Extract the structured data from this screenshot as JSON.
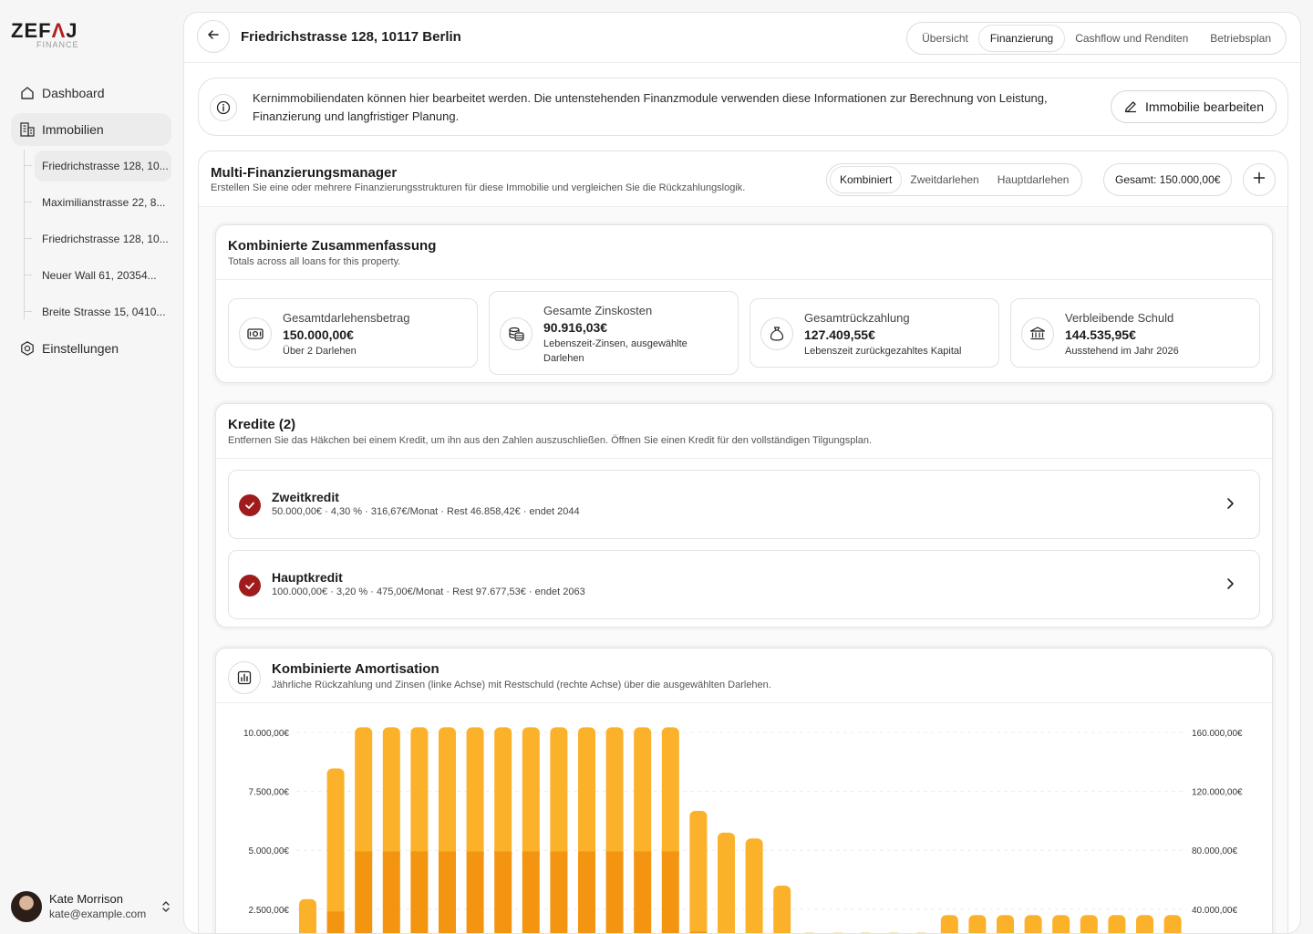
{
  "brand": {
    "name_left": "ZEF",
    "name_accent": "Λ",
    "name_right": "J",
    "sub": "FINANCE"
  },
  "sidebar": {
    "nav": [
      {
        "label": "Dashboard",
        "icon": "home-icon"
      },
      {
        "label": "Immobilien",
        "icon": "building-icon"
      },
      {
        "label": "Einstellungen",
        "icon": "settings-icon"
      }
    ],
    "properties": [
      "Friedrichstrasse 128, 10...",
      "Maximilianstrasse 22, 8...",
      "Friedrichstrasse 128, 10...",
      "Neuer Wall 61, 20354...",
      "Breite Strasse 15, 0410..."
    ],
    "user": {
      "name": "Kate Morrison",
      "email": "kate@example.com"
    }
  },
  "header": {
    "title": "Friedrichstrasse 128, 10117 Berlin",
    "tabs": [
      "Übersicht",
      "Finanzierung",
      "Cashflow und Renditen",
      "Betriebsplan"
    ],
    "active_tab": "Finanzierung"
  },
  "info": {
    "text": "Kernimmobiliendaten können hier bearbeitet werden. Die untenstehenden Finanzmodule verwenden diese Informationen zur Berechnung von Leistung, Finanzierung und langfristiger Planung.",
    "button": "Immobilie bearbeiten"
  },
  "manager": {
    "title": "Multi-Finanzierungsmanager",
    "subtitle": "Erstellen Sie eine oder mehrere Finanzierungsstrukturen für diese Immobilie und vergleichen Sie die Rückzahlungslogik.",
    "segments": [
      "Kombiniert",
      "Zweitdarlehen",
      "Hauptdarlehen"
    ],
    "active_segment": "Kombiniert",
    "total": "Gesamt: 150.000,00€"
  },
  "summary": {
    "title": "Kombinierte Zusammenfassung",
    "subtitle": "Totals across all loans for this property.",
    "stats": [
      {
        "label": "Gesamtdarlehensbetrag",
        "value": "150.000,00€",
        "note": "Über 2 Darlehen",
        "icon": "cash-icon"
      },
      {
        "label": "Gesamte Zinskosten",
        "value": "90.916,03€",
        "note": "Lebenszeit-Zinsen, ausgewählte Darlehen",
        "icon": "coins-icon"
      },
      {
        "label": "Gesamtrückzahlung",
        "value": "127.409,55€",
        "note": "Lebenszeit zurückgezahltes Kapital",
        "icon": "money-bag-icon"
      },
      {
        "label": "Verbleibende Schuld",
        "value": "144.535,95€",
        "note": "Ausstehend im Jahr 2026",
        "icon": "bank-icon"
      }
    ]
  },
  "loans": {
    "title": "Kredite (2)",
    "subtitle": "Entfernen Sie das Häkchen bei einem Kredit, um ihn aus den Zahlen auszuschließen. Öffnen Sie einen Kredit für den vollständigen Tilgungsplan.",
    "items": [
      {
        "name": "Zweitkredit",
        "meta": "50.000,00€ · 4,30 % · 316,67€/Monat · Rest 46.858,42€ · endet 2044"
      },
      {
        "name": "Hauptkredit",
        "meta": "100.000,00€ · 3,20 % · 475,00€/Monat · Rest 97.677,53€ · endet 2063"
      }
    ]
  },
  "amortization": {
    "title": "Kombinierte Amortisation",
    "subtitle": "Jährliche Rückzahlung und Zinsen (linke Achse) mit Restschuld (rechte Achse) über die ausgewählten Darlehen."
  },
  "colors": {
    "accent": "#a01c1c",
    "bar_light": "#fbb12a",
    "bar_dark": "#f39511"
  },
  "chart_data": {
    "type": "bar",
    "left_ticks": [
      "10.000,00€",
      "7.500,00€",
      "5.000,00€",
      "2.500,00€"
    ],
    "right_ticks": [
      "160.000,00€",
      "120.000,00€",
      "80.000,00€",
      "40.000,00€"
    ],
    "ylim": [
      0,
      10000
    ],
    "series": [
      {
        "name": "",
        "values": [
          280,
          2400,
          4950,
          4950,
          4950,
          4950,
          4950,
          4950,
          4950,
          4950,
          4950,
          4950,
          4950,
          4950,
          1550,
          1000,
          1050,
          630,
          100,
          100,
          100,
          100,
          100,
          150,
          150,
          150,
          150,
          150,
          150,
          150,
          150,
          150
        ]
      },
      {
        "name": "",
        "values": [
          2650,
          6070,
          5270,
          5270,
          5270,
          5270,
          5270,
          5270,
          5270,
          5270,
          5270,
          5270,
          5270,
          5270,
          5120,
          4750,
          4450,
          2870,
          1400,
          1400,
          1400,
          1400,
          1400,
          2100,
          2100,
          2100,
          2100,
          2100,
          2100,
          2100,
          2100,
          2100
        ]
      }
    ]
  }
}
